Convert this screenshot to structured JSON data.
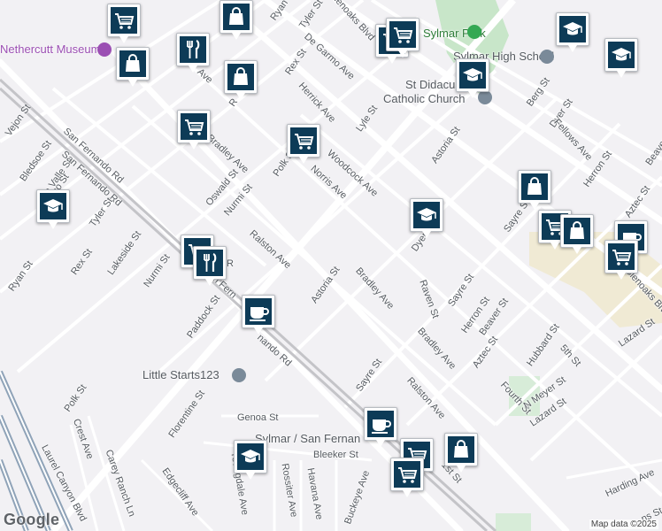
{
  "colors": {
    "marker": "#0d3b57",
    "park": "#c8e6c9",
    "commercial": "#f0ead4",
    "freeway": "#8fa3b8",
    "road": "#ffffff"
  },
  "map": {
    "places": {
      "museum": "Nethercutt Museum",
      "park": "Sylmar Park",
      "school": "Sylmar High School",
      "church_line1": "St Didacus",
      "church_line2": "Catholic Church",
      "daycare": "Little Starts123",
      "station": "Sylmar / San Fernan"
    },
    "streets": {
      "tyler_top": "Tyler St",
      "glenoaks_top": "Glenoaks Blvd",
      "de_garmo": "De Garmo Ave",
      "rex_top": "Rex St",
      "herrick": "Herrick Ave",
      "lyle": "Lyle St",
      "berg": "Berg St",
      "dyer_top": "Dyer St",
      "fellows": "Fellows Ave",
      "beaver_top": "Beaver St",
      "herron_top": "Herron St",
      "aztec_top": "Aztec St",
      "sayre_right": "Sayre St",
      "glenoaks_right": "Glenoaks Blvd",
      "lazard_right": "Lazard St",
      "astoria_top": "Astoria St",
      "woodcock": "Woodcock Ave",
      "norris": "Norris Ave",
      "polk_mid": "Polk St",
      "bradley_top": "Bradley Ave",
      "oswald": "Oswald St",
      "nurmi_top": "Nurmi St",
      "ralston_mid": "Ralston Ave",
      "dyer_mid": "Dyer St",
      "bledsoe": "Bledsoe St",
      "la_valle": "La Valle St",
      "san_fernando_1": "San Fernando Rd",
      "san_fernando_2": "San Fernando Rd",
      "tyler_left": "Tyler St",
      "lakeside": "Lakeside St",
      "rex_left": "Rex St",
      "nurmi_left": "Nurmi St",
      "ryan": "Ryan St",
      "paddock": "Paddock St",
      "astoria_mid": "Astoria St",
      "bradley_mid": "Bradley Ave",
      "raven": "Raven St",
      "sayre_mid": "Sayre St",
      "herron_mid": "Herron St",
      "beaver_mid": "Beaver St",
      "aztec_mid": "Aztec St",
      "bradley_low": "Bradley Ave",
      "hubbard": "Hubbard St",
      "fifth": "5th St",
      "fourth": "Fourth St",
      "n_meyer": "N Meyer St",
      "lazard_low": "Lazard St",
      "sayre_low": "Sayre St",
      "ralston_low": "Ralston Ave",
      "polk_low": "Polk St",
      "florentine": "Florentine St",
      "genoa": "Genoa St",
      "crest": "Crest Ave",
      "carey_ranch": "Carey Ranch Ln",
      "laurel_canyon": "Laurel Canyon Blvd",
      "edgecliff": "Edgecliff Ave",
      "youngdale": "Youngdale Ave",
      "rossiter": "Rossiter Ave",
      "havana": "Havana Ave",
      "bleeker": "Bleeker St",
      "buckeye": "Buckeye Ave",
      "harding": "Harding Ave",
      "first": "1st St",
      "ryan_top": "Ryan St",
      "avenue_top": "Ave",
      "harding_edge": "ns St",
      "canyon_left": "Vejon St",
      "fern_mid": "San Fern",
      "fernando_mid": "nando Rd",
      "ave_left": "Ave",
      "st_left": "co St",
      "r_mark": "R",
      "s_mark": "S",
      "t_mark": "S",
      "trans_mark": "T"
    },
    "pins": [
      {
        "icon": "shopping-cart-icon"
      },
      {
        "icon": "shopping-bag-icon"
      },
      {
        "icon": "shopping-bag-icon"
      },
      {
        "icon": "shopping-cart-icon"
      },
      {
        "icon": "shopping-cart-icon"
      },
      {
        "icon": "school-icon"
      },
      {
        "icon": "school-icon"
      },
      {
        "icon": "school-icon"
      },
      {
        "icon": "restaurant-icon"
      },
      {
        "icon": "shopping-bag-icon"
      },
      {
        "icon": "shopping-cart-icon"
      },
      {
        "icon": "shopping-cart-icon"
      },
      {
        "icon": "school-icon"
      },
      {
        "icon": "school-icon"
      },
      {
        "icon": "shopping-bag-icon"
      },
      {
        "icon": "shopping-cart-icon"
      },
      {
        "icon": "shopping-bag-icon"
      },
      {
        "icon": "coffee-icon"
      },
      {
        "icon": "shopping-cart-icon"
      },
      {
        "icon": "shopping-cart-icon"
      },
      {
        "icon": "restaurant-icon"
      },
      {
        "icon": "coffee-icon"
      },
      {
        "icon": "coffee-icon"
      },
      {
        "icon": "school-icon"
      },
      {
        "icon": "shopping-cart-icon"
      },
      {
        "icon": "shopping-cart-icon"
      },
      {
        "icon": "shopping-bag-icon"
      }
    ]
  },
  "footer": {
    "logo": "Google",
    "attribution": "Map data ©2025"
  }
}
